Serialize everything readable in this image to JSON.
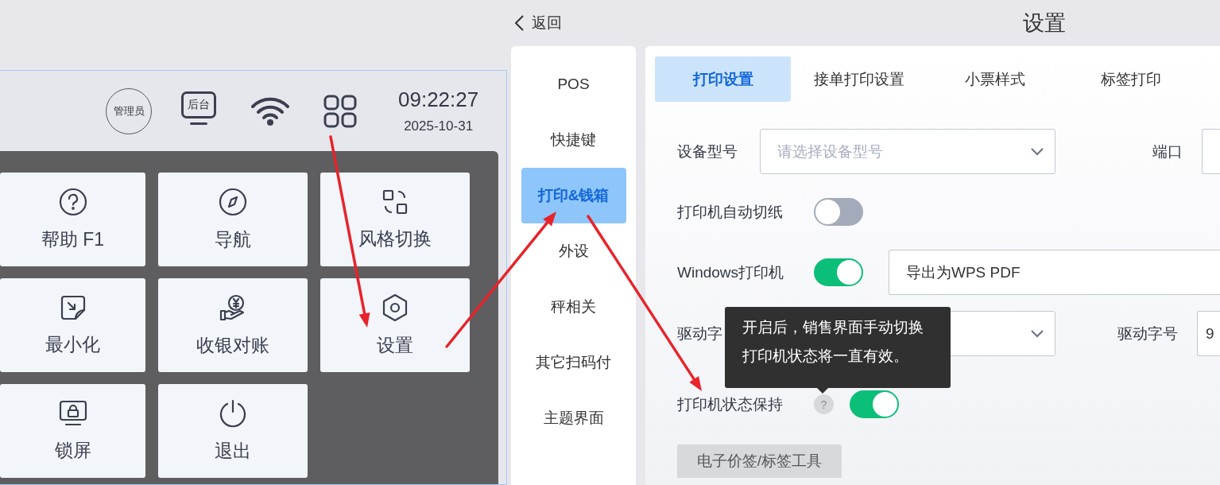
{
  "pos": {
    "header": {
      "user_badge": "管理员",
      "backend_label": "后台",
      "time": "09:22:27",
      "date": "2025-10-31"
    },
    "menu": [
      {
        "label": "帮助 F1",
        "kind": "help"
      },
      {
        "label": "导航",
        "kind": "compass"
      },
      {
        "label": "风格切换",
        "kind": "swap"
      },
      {
        "label": "最小化",
        "kind": "minimize"
      },
      {
        "label": "收银对账",
        "kind": "cash"
      },
      {
        "label": "设置",
        "kind": "settings"
      },
      {
        "label": "锁屏",
        "kind": "lock"
      },
      {
        "label": "退出",
        "kind": "power"
      }
    ]
  },
  "settings": {
    "back": "返回",
    "title": "设置",
    "nav": [
      {
        "label": "POS",
        "selected": false
      },
      {
        "label": "快捷键",
        "selected": false
      },
      {
        "label": "打印&钱箱",
        "selected": true
      },
      {
        "label": "外设",
        "selected": false
      },
      {
        "label": "秤相关",
        "selected": false
      },
      {
        "label": "其它扫码付",
        "selected": false
      },
      {
        "label": "主题界面",
        "selected": false
      }
    ],
    "tabs": [
      {
        "label": "打印设置",
        "selected": true
      },
      {
        "label": "接单打印设置",
        "selected": false
      },
      {
        "label": "小票样式",
        "selected": false
      },
      {
        "label": "标签打印",
        "selected": false
      }
    ],
    "device_model": {
      "label": "设备型号",
      "placeholder": "请选择设备型号"
    },
    "port": {
      "label": "端口"
    },
    "auto_cut": {
      "label": "打印机自动切纸",
      "on": false
    },
    "windows_printer": {
      "label": "Windows打印机",
      "on": true,
      "value": "导出为WPS PDF"
    },
    "driver_font": {
      "label": "驱动字"
    },
    "driver_size": {
      "label": "驱动字号",
      "value": "9"
    },
    "keep_state": {
      "label": "打印机状态保持",
      "help": "?",
      "on": true
    },
    "tooltip": [
      "开启后，销售界面手动切换",
      "打印机状态将一直有效。"
    ],
    "tool_button": "电子价签/标签工具"
  }
}
